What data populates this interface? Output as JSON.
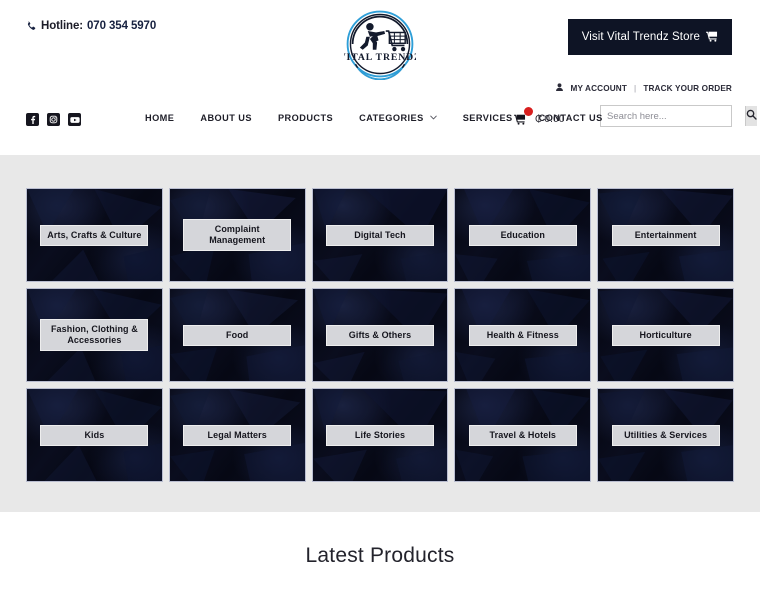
{
  "header": {
    "hotline_label": "Hotline:",
    "hotline_number": "070 354 5970",
    "phone_icon": "phone-icon",
    "logo": {
      "brand": "VITAL TRENDZ",
      "icon": "runner-with-shopping-cart-logo",
      "ring_color": "#2f9fd8",
      "mark_color": "#131a2c"
    },
    "store_button": {
      "label": "Visit Vital Trendz Store",
      "icon": "shopping-cart-icon",
      "bg": "#0e1425",
      "fg": "#ffffff"
    },
    "account": {
      "person_icon": "user-icon",
      "my_account": "MY ACCOUNT",
      "divider": "|",
      "track_order": "TRACK YOUR ORDER"
    },
    "search": {
      "placeholder": "Search here...",
      "value": "",
      "button_icon": "search-icon"
    },
    "social": [
      {
        "name": "facebook-icon",
        "glyph": "f"
      },
      {
        "name": "instagram-icon",
        "glyph": "◎"
      },
      {
        "name": "youtube-icon",
        "glyph": "▶"
      }
    ],
    "nav": [
      {
        "label": "HOME",
        "has_caret": false
      },
      {
        "label": "ABOUT US",
        "has_caret": false
      },
      {
        "label": "PRODUCTS",
        "has_caret": false
      },
      {
        "label": "CATEGORIES",
        "has_caret": true
      },
      {
        "label": "SERVICES",
        "has_caret": false
      },
      {
        "label": "CONTACT US",
        "has_caret": false
      }
    ],
    "cart": {
      "icon": "shopping-cart-icon",
      "badge_count": "",
      "badge_color": "#d81e1e",
      "currency": "₵",
      "amount": "0.00"
    }
  },
  "categories": {
    "background": "#e8e8e8",
    "tiles": [
      {
        "label": "Arts, Crafts & Culture"
      },
      {
        "label": "Complaint Management"
      },
      {
        "label": "Digital Tech"
      },
      {
        "label": "Education"
      },
      {
        "label": "Entertainment"
      },
      {
        "label": "Fashion, Clothing & Accessories"
      },
      {
        "label": "Food"
      },
      {
        "label": "Gifts & Others"
      },
      {
        "label": "Health & Fitness"
      },
      {
        "label": "Horticulture"
      },
      {
        "label": "Kids"
      },
      {
        "label": "Legal Matters"
      },
      {
        "label": "Life Stories"
      },
      {
        "label": "Travel & Hotels"
      },
      {
        "label": "Utilities & Services"
      }
    ]
  },
  "latest_products": {
    "title": "Latest Products"
  }
}
